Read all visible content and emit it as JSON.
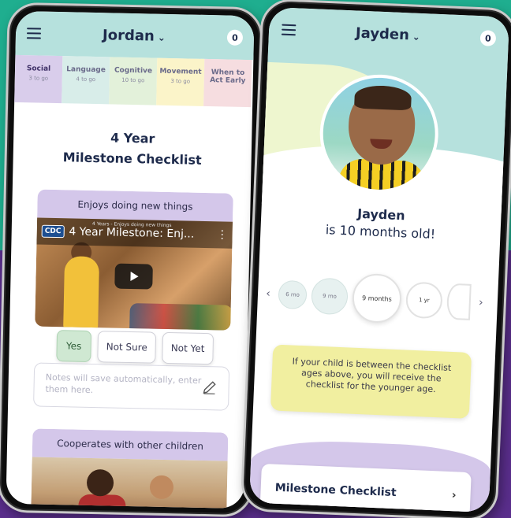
{
  "colors": {
    "teal_bg": "#1fae8f",
    "purple_bg": "#5a2e8c",
    "header_teal": "#b6e1dd",
    "lavender": "#d4c7ea",
    "note_yellow": "#f1efa0",
    "yes_green": "#cfe8d2"
  },
  "left": {
    "header": {
      "child_name": "Jordan",
      "badge": "0"
    },
    "tabs": [
      {
        "label": "Social",
        "sub": "3 to go"
      },
      {
        "label": "Language",
        "sub": "4 to go"
      },
      {
        "label": "Cognitive",
        "sub": "10 to go"
      },
      {
        "label": "Movement",
        "sub": "3 to go"
      },
      {
        "label": "When to Act Early",
        "sub": ""
      }
    ],
    "title_line1": "4 Year",
    "title_line2": "Milestone Checklist",
    "milestone1": {
      "title": "Enjoys doing new things",
      "video_logo": "CDC",
      "video_title": "4 Year Milestone: Enj...",
      "video_small": "4 Years - Enjoys doing new things"
    },
    "answers": {
      "yes": "Yes",
      "not_sure": "Not Sure",
      "not_yet": "Not Yet"
    },
    "notes_placeholder": "Notes will save automatically, enter them here.",
    "milestone2": {
      "title": "Cooperates with other children"
    }
  },
  "right": {
    "header": {
      "child_name": "Jayden",
      "badge": "0"
    },
    "child_name": "Jayden",
    "age_line": "is 10 months old!",
    "ages": [
      {
        "label": "6 mo"
      },
      {
        "label": "9 mo"
      },
      {
        "label": "9 months"
      },
      {
        "label": "1 yr"
      },
      {
        "label": ""
      }
    ],
    "note": "If your child is between the checklist ages above, you will receive the checklist for the younger age.",
    "milestone_button": "Milestone Checklist"
  }
}
